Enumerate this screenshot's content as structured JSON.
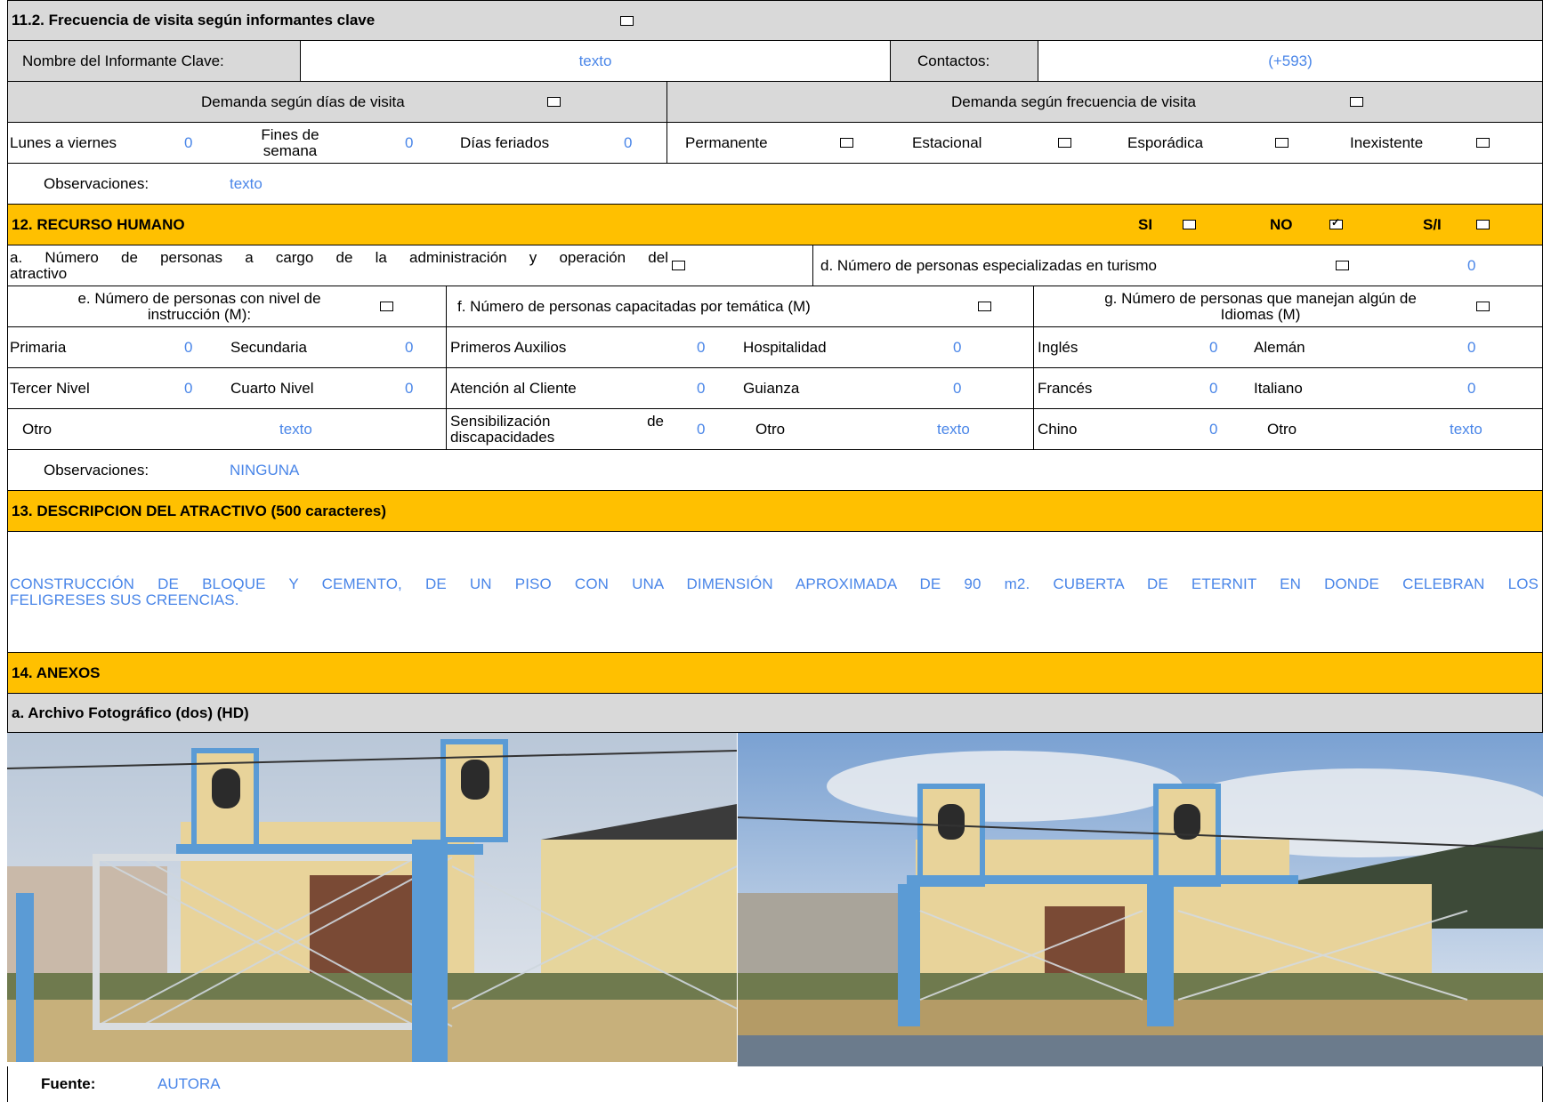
{
  "s11_2": {
    "title": "11.2. Frecuencia de visita según informantes clave",
    "informante_label": "Nombre del Informante Clave:",
    "informante_value": "texto",
    "contactos_label": "Contactos:",
    "contactos_value": "(+593)",
    "demanda_dias": "Demanda según  días de visita",
    "demanda_freq": "Demanda según frecuencia de visita",
    "lunes_label": "Lunes a viernes",
    "lunes_value": "0",
    "fines_label_1": "Fines de",
    "fines_label_2": "semana",
    "fines_value": "0",
    "feriados_label": "Días feriados",
    "feriados_value": "0",
    "permanente": "Permanente",
    "estacional": "Estacional",
    "esporadica": "Esporádica",
    "inexistente": "Inexistente",
    "obs_label": "Observaciones:",
    "obs_value": "texto"
  },
  "s12": {
    "title": "12. RECURSO HUMANO",
    "si": "SI",
    "no": "NO",
    "si_checked": false,
    "no_checked": true,
    "sn": "S/I",
    "a_label_1": "a. Número de personas a cargo de la administración y operación del",
    "a_label_2": "atractivo",
    "d_label": "d. Número de personas especializadas en turismo",
    "d_value": "0",
    "e_label_1": "e. Número de personas con nivel de",
    "e_label_2": "instrucción (M):",
    "f_label": "f. Número de personas capacitadas por temática (M)",
    "g_label_1": "g. Número de personas que manejan algún de",
    "g_label_2": "Idiomas (M)",
    "primaria": "Primaria",
    "primaria_v": "0",
    "secundaria": "Secundaria",
    "secundaria_v": "0",
    "primeros": "Primeros Auxilios",
    "primeros_v": "0",
    "hospitalidad": "Hospitalidad",
    "hospitalidad_v": "0",
    "ingles": "Inglés",
    "ingles_v": "0",
    "aleman": "Alemán",
    "aleman_v": "0",
    "tercer": "Tercer Nivel",
    "tercer_v": "0",
    "cuarto": "Cuarto Nivel",
    "cuarto_v": "0",
    "atencion": "Atención al Cliente",
    "atencion_v": "0",
    "guianza": "Guianza",
    "guianza_v": "0",
    "frances": "Francés",
    "frances_v": "0",
    "italiano": "Italiano",
    "italiano_v": "0",
    "otro1": "Otro",
    "otro1_v": "texto",
    "sensib_1": "Sensibilización",
    "sensib_de": "de",
    "sensib_2": "discapacidades",
    "sensib_v": "0",
    "otro2": "Otro",
    "otro2_v": "texto",
    "chino": "Chino",
    "chino_v": "0",
    "otro3": "Otro",
    "otro3_v": "texto",
    "obs_label": "Observaciones:",
    "obs_value": "NINGUNA"
  },
  "s13": {
    "title": "13. DESCRIPCION DEL ATRACTIVO (500 caracteres)",
    "line1": "CONSTRUCCIÓN DE BLOQUE Y CEMENTO, DE UN PISO CON UNA DIMENSIÓN APROXIMADA DE 90 m2. CUBERTA DE ETERNIT EN DONDE CELEBRAN LOS",
    "line2": "FELIGRESES SUS CREENCIAS."
  },
  "s14": {
    "title": "14. ANEXOS",
    "archivo": "a. Archivo Fotográfico (dos) (HD)",
    "fuente_label": "Fuente:",
    "fuente_value": "AUTORA"
  },
  "colors": {
    "accent": "#ffc000",
    "header_gray": "#d9d9d9",
    "value_blue": "#4a86e8"
  }
}
